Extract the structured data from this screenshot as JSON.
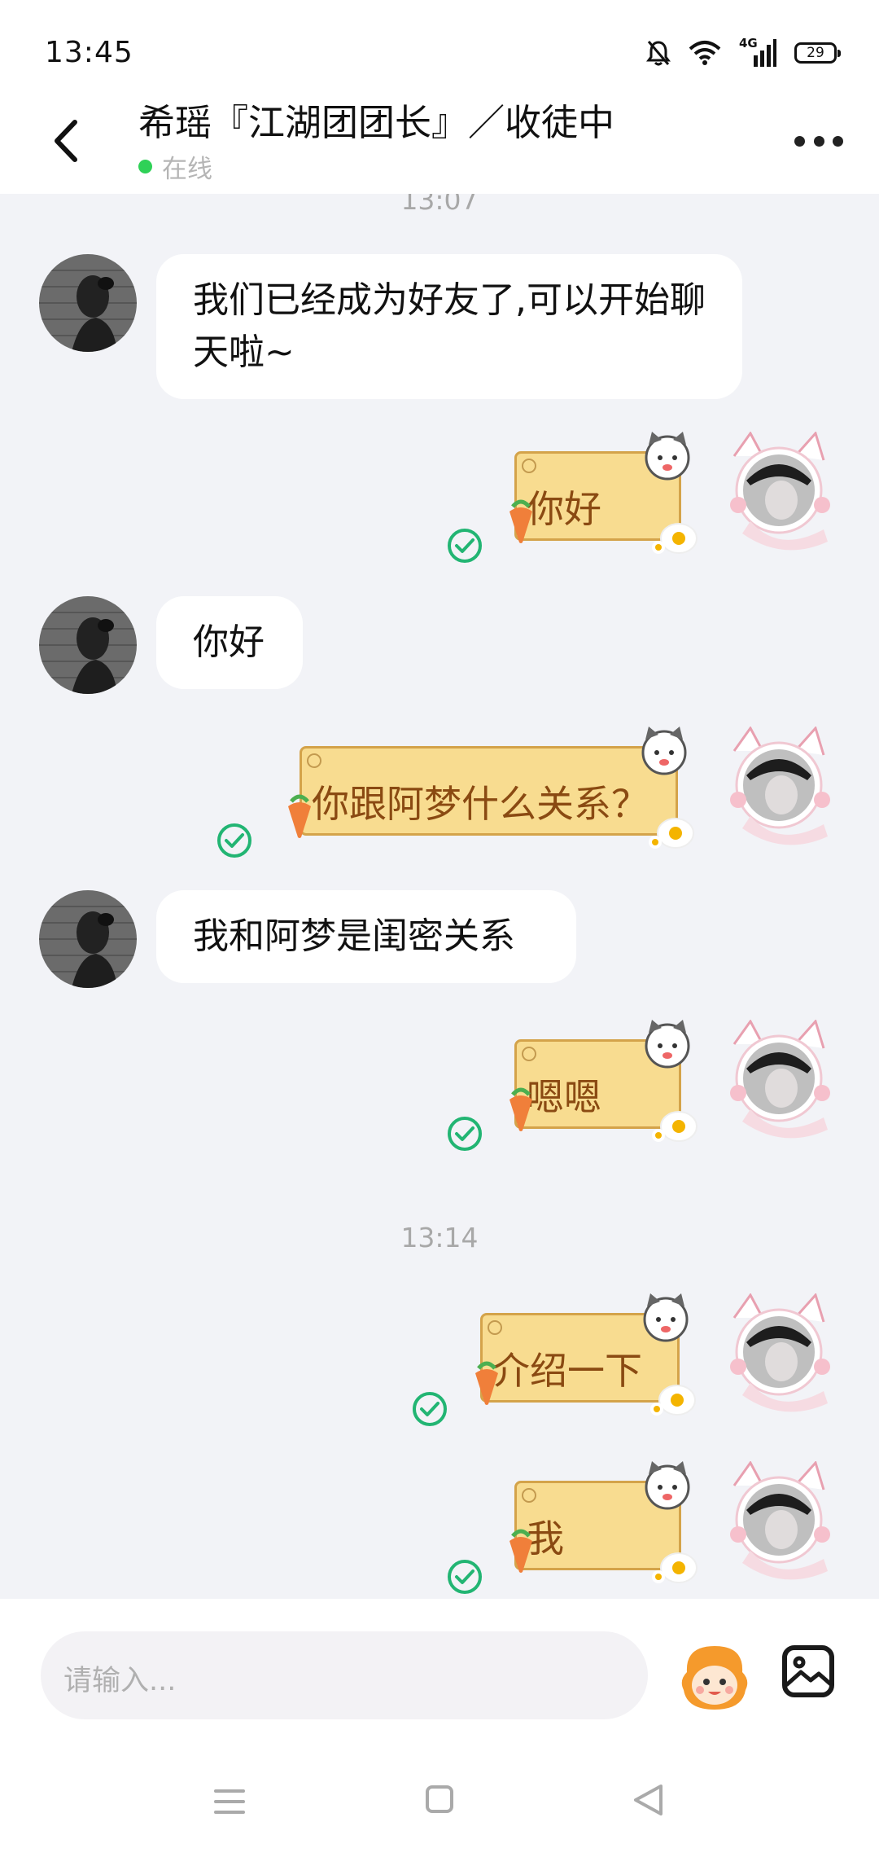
{
  "status_bar": {
    "time": "13:45",
    "battery": "29",
    "network": "4G"
  },
  "header": {
    "title": "希瑶『江湖团团长』／收徒中",
    "status": "在线"
  },
  "timestamps": [
    "13:07",
    "13:14"
  ],
  "messages": [
    {
      "side": "left",
      "text": "我们已经成为好友了,可以开始聊天啦~"
    },
    {
      "side": "right",
      "text": "你好",
      "read": true
    },
    {
      "side": "left",
      "text": "你好"
    },
    {
      "side": "right",
      "text": "你跟阿梦什么关系？",
      "read": true
    },
    {
      "side": "left",
      "text": "我和阿梦是闺密关系"
    },
    {
      "side": "right",
      "text": "嗯嗯",
      "read": true
    },
    {
      "side": "right",
      "text": "介绍一下",
      "read": true
    },
    {
      "side": "right",
      "text": "我",
      "read": true
    }
  ],
  "input": {
    "placeholder": "请输入..."
  },
  "icons": [
    "back-icon",
    "more-icon",
    "mute-icon",
    "wifi-icon",
    "signal-icon",
    "battery-icon",
    "read-check-icon",
    "emoji-icon",
    "image-icon",
    "nav-menu-icon",
    "nav-home-icon",
    "nav-back-icon"
  ],
  "colors": {
    "online": "#2fd157",
    "check": "#22b573",
    "sticker_note": "#f8dc90",
    "sticker_text": "#8a4a12"
  }
}
